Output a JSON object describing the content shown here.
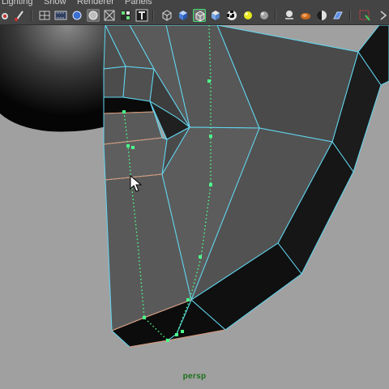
{
  "menu": {
    "items": [
      "Lighting",
      "Show",
      "Renderer",
      "Panels"
    ]
  },
  "toolbar": {
    "buttons": [
      {
        "icon": "bookmark-icon"
      },
      {
        "icon": "paint-brush-icon"
      },
      {
        "icon": "grid-icon"
      },
      {
        "icon": "film-gate-icon"
      },
      {
        "icon": "smooth-shade-icon"
      },
      {
        "icon": "wireframe-shade-icon",
        "active": true
      },
      {
        "icon": "xray-icon"
      },
      {
        "icon": "texture-icon"
      },
      {
        "icon": "text-icon"
      },
      {
        "icon": "wireframe-cube-icon"
      },
      {
        "icon": "shaded-cube-icon"
      },
      {
        "icon": "wireframe-on-shaded-icon",
        "active": true
      },
      {
        "icon": "textured-cube-icon"
      },
      {
        "icon": "checker-texture-icon"
      },
      {
        "icon": "all-lights-icon"
      },
      {
        "icon": "shadows-icon"
      },
      {
        "icon": "default-light-icon"
      },
      {
        "icon": "ambient-occlusion-icon"
      },
      {
        "icon": "contrast-icon"
      },
      {
        "icon": "motion-blur-icon"
      },
      {
        "icon": "isolate-select-icon"
      },
      {
        "icon": "overflow-icon"
      }
    ]
  },
  "viewport": {
    "camera": "persp",
    "colors": {
      "background": "#a0a0a0",
      "wire": "#61d8f2",
      "selected_edge": "#4dff8c",
      "highlight_edge": "#e2906c"
    }
  }
}
